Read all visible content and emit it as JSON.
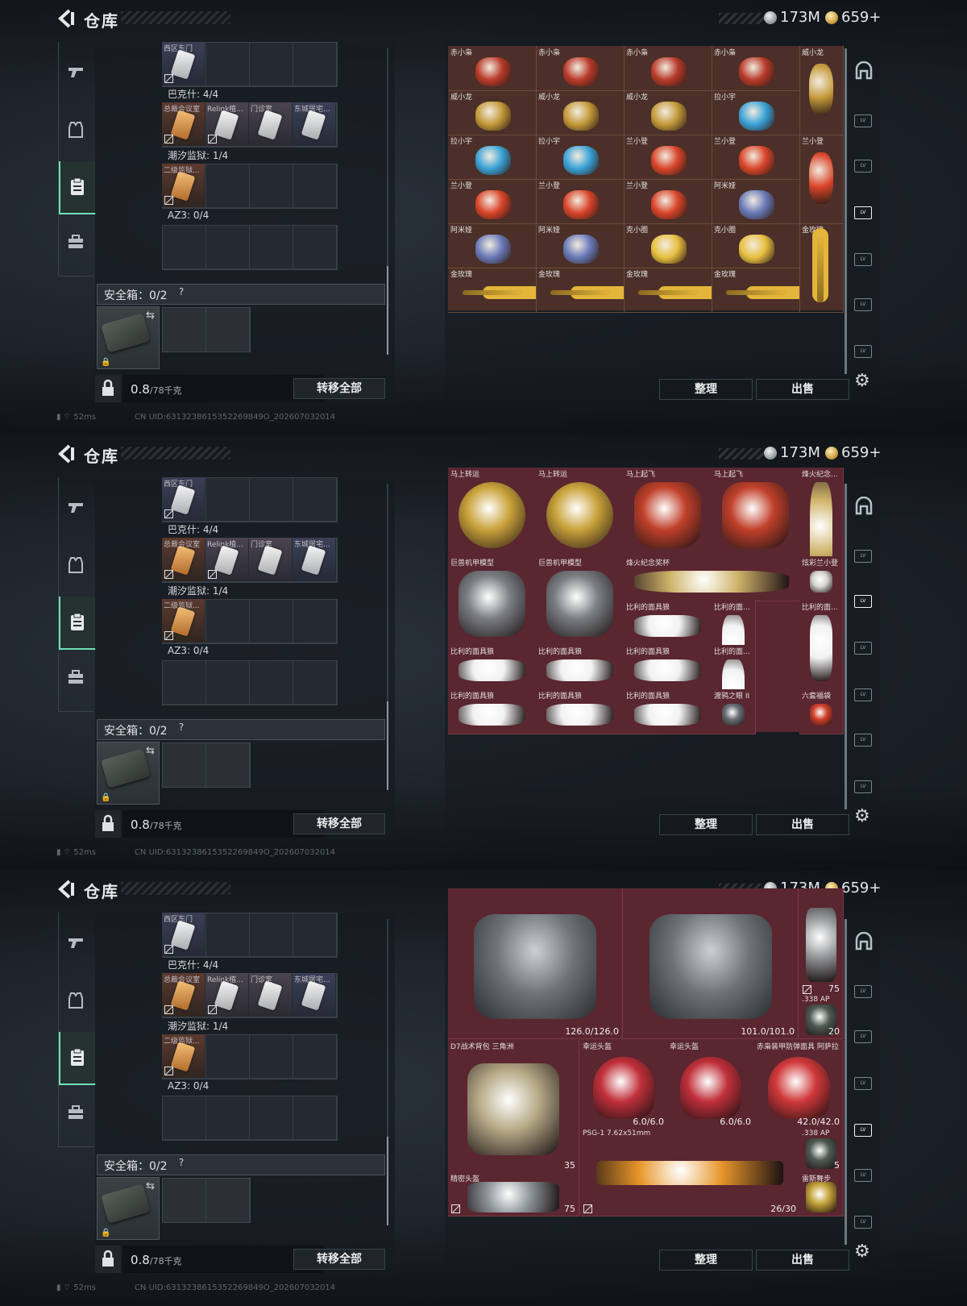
{
  "header": {
    "title": "仓库",
    "silver_amount": "173M",
    "gold_amount": "659+",
    "silver_color": "#a7adb3",
    "gold_color": "#c89a3c"
  },
  "left": {
    "slots": [
      {
        "label": "巴克什: 4/4"
      },
      {
        "label": "潮汐监狱: 1/4"
      },
      {
        "label": "AZ3: 0/4"
      }
    ],
    "top_key": "西区东门",
    "baksh_keys": [
      "总裁会议室",
      "Relink植...",
      "门诊室",
      "东城居宅..."
    ],
    "tide_keys": [
      "二级监狱..."
    ],
    "safe_label": "安全箱：0/2",
    "safe_help": "?",
    "weight_value": "0.8",
    "weight_unit": "/78千克",
    "transfer_label": "转移全部"
  },
  "actions": {
    "sort_label": "整理",
    "sell_label": "出售"
  },
  "status": {
    "ping": "52ms",
    "uid": "CN UID:6313238615352269849O_202607032014"
  },
  "panel1": {
    "items": [
      {
        "name": "赤小枭",
        "kind": "owl"
      },
      {
        "name": "赤小枭",
        "kind": "owl"
      },
      {
        "name": "赤小枭",
        "kind": "owl"
      },
      {
        "name": "赤小枭",
        "kind": "owl"
      },
      {
        "name": "威小龙",
        "kind": "dragon-tall"
      },
      {
        "name": "威小龙",
        "kind": "dragon"
      },
      {
        "name": "威小龙",
        "kind": "dragon"
      },
      {
        "name": "威小龙",
        "kind": "dragon"
      },
      {
        "name": "拉小宇",
        "kind": "blue"
      },
      {
        "name": "拉小宇",
        "kind": "blue"
      },
      {
        "name": "拉小宇",
        "kind": "blue"
      },
      {
        "name": "兰小登",
        "kind": "mariachi"
      },
      {
        "name": "兰小登",
        "kind": "mariachi"
      },
      {
        "name": "兰小登",
        "kind": "mariachi-tall"
      },
      {
        "name": "兰小登",
        "kind": "mariachi"
      },
      {
        "name": "兰小登",
        "kind": "mariachi"
      },
      {
        "name": "兰小登",
        "kind": "mariachi"
      },
      {
        "name": "阿米娅",
        "kind": "bunny"
      },
      {
        "name": "阿米娅",
        "kind": "bunny"
      },
      {
        "name": "阿米娅",
        "kind": "bunny"
      },
      {
        "name": "克小圈",
        "kind": "round"
      },
      {
        "name": "克小圈",
        "kind": "round"
      },
      {
        "name": "金玫瑰",
        "kind": "rose-tall"
      },
      {
        "name": "金玫瑰",
        "kind": "rose"
      },
      {
        "name": "金玫瑰",
        "kind": "rose"
      },
      {
        "name": "金玫瑰",
        "kind": "rose"
      },
      {
        "name": "金玫瑰",
        "kind": "rose"
      }
    ]
  },
  "panel2": {
    "items": [
      {
        "name": "马上转运"
      },
      {
        "name": "马上转运"
      },
      {
        "name": "马上起飞"
      },
      {
        "name": "马上起飞"
      },
      {
        "name": "烽火纪念..."
      },
      {
        "name": "巨兽机甲模型"
      },
      {
        "name": "巨兽机甲模型"
      },
      {
        "name": "烽火纪念奖杯"
      },
      {
        "name": "炫彩兰小登"
      },
      {
        "name": "比利的面具狼"
      },
      {
        "name": "比利的面..."
      },
      {
        "name": "比利的面..."
      },
      {
        "name": "比利的面具狼"
      },
      {
        "name": "比利的面具狼"
      },
      {
        "name": "比利的面具狼"
      },
      {
        "name": "比利的面..."
      },
      {
        "name": "比利的面具狼"
      },
      {
        "name": "比利的面具狼"
      },
      {
        "name": "比利的面具狼"
      },
      {
        "name": "渡鸦之眼 II"
      },
      {
        "name": "六套福袋"
      }
    ]
  },
  "panel3": {
    "items": [
      {
        "name": "",
        "value": "126.0/126.0"
      },
      {
        "name": "",
        "value": "101.0/101.0"
      },
      {
        "name": "",
        "badge": "75"
      },
      {
        "name": ".338 AP",
        "value": "20"
      },
      {
        "name": "D7战术背包 三角洲",
        "value": "35"
      },
      {
        "name": "幸运头盔",
        "value": "6.0/6.0"
      },
      {
        "name": "幸运头盔",
        "value": "6.0/6.0"
      },
      {
        "name": "赤枭装甲防弹面具 阿萨拉",
        "value": "42.0/42.0"
      },
      {
        "name": "PSG-1 7.62x51mm",
        "value": "26/30"
      },
      {
        "name": ".338 AP",
        "value": "5"
      },
      {
        "name": "精密头盔",
        "value": "75"
      },
      {
        "name": "雷斯舞步",
        "value": ""
      }
    ]
  }
}
